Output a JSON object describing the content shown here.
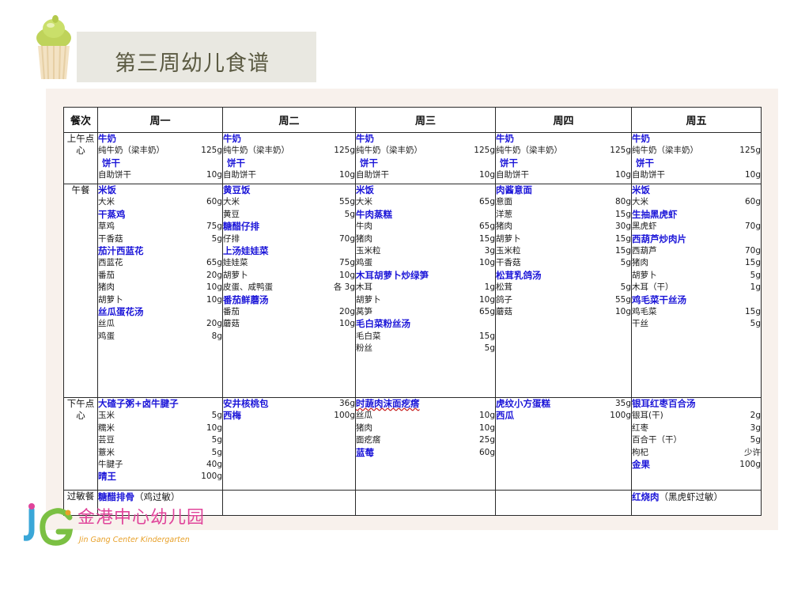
{
  "title": "第三周幼儿食谱",
  "header": [
    "餐次",
    "周一",
    "周二",
    "周三",
    "周四",
    "周五"
  ],
  "meals": [
    {
      "label": "上午点心",
      "days": [
        [
          {
            "t": "d",
            "name": "牛奶"
          },
          {
            "t": "i",
            "name": "纯牛奶（梁丰奶）",
            "qty": "125g"
          },
          {
            "t": "d",
            "name": "饼干",
            "indent": true
          },
          {
            "t": "i",
            "name": "自助饼干",
            "qty": "10g"
          }
        ],
        [
          {
            "t": "d",
            "name": "牛奶"
          },
          {
            "t": "i",
            "name": "纯牛奶（梁丰奶）",
            "qty": "125g"
          },
          {
            "t": "d",
            "name": "饼干",
            "indent": true
          },
          {
            "t": "i",
            "name": "自助饼干",
            "qty": "10g"
          }
        ],
        [
          {
            "t": "d",
            "name": "牛奶"
          },
          {
            "t": "i",
            "name": "纯牛奶（梁丰奶）",
            "qty": "125g"
          },
          {
            "t": "d",
            "name": "饼干",
            "indent": true
          },
          {
            "t": "i",
            "name": "自助饼干",
            "qty": "10g"
          }
        ],
        [
          {
            "t": "d",
            "name": "牛奶"
          },
          {
            "t": "i",
            "name": "纯牛奶（梁丰奶）",
            "qty": "125g"
          },
          {
            "t": "d",
            "name": "饼干",
            "indent": true
          },
          {
            "t": "i",
            "name": "自助饼干",
            "qty": "10g"
          }
        ],
        [
          {
            "t": "d",
            "name": "牛奶"
          },
          {
            "t": "i",
            "name": "纯牛奶（梁丰奶）",
            "qty": "125g"
          },
          {
            "t": "d",
            "name": "饼干",
            "indent": true
          },
          {
            "t": "i",
            "name": "自助饼干",
            "qty": "10g"
          }
        ]
      ]
    },
    {
      "label": "午餐",
      "days": [
        [
          {
            "t": "d",
            "name": "米饭"
          },
          {
            "t": "i",
            "name": "大米",
            "qty": "60g"
          },
          {
            "t": "d",
            "name": "干蒸鸡"
          },
          {
            "t": "i",
            "name": "草鸡",
            "qty": "75g"
          },
          {
            "t": "i",
            "name": "干香菇",
            "qty": "5g"
          },
          {
            "t": "d",
            "name": "茄汁西蓝花"
          },
          {
            "t": "i",
            "name": "西蓝花",
            "qty": "65g"
          },
          {
            "t": "i",
            "name": "番茄",
            "qty": "20g"
          },
          {
            "t": "i",
            "name": "猪肉",
            "qty": "10g"
          },
          {
            "t": "i",
            "name": "胡萝卜",
            "qty": "10g"
          },
          {
            "t": "d",
            "name": "丝瓜蛋花汤"
          },
          {
            "t": "i",
            "name": "丝瓜",
            "qty": "20g"
          },
          {
            "t": "i",
            "name": "鸡蛋",
            "qty": "8g"
          }
        ],
        [
          {
            "t": "d",
            "name": "黄豆饭"
          },
          {
            "t": "i",
            "name": "大米",
            "qty": "55g"
          },
          {
            "t": "i",
            "name": "黄豆",
            "qty": "5g"
          },
          {
            "t": "d",
            "name": "糖醋仔排"
          },
          {
            "t": "i",
            "name": "仔排",
            "qty": "70g"
          },
          {
            "t": "d",
            "name": "上汤娃娃菜"
          },
          {
            "t": "i",
            "name": "娃娃菜",
            "qty": "75g"
          },
          {
            "t": "i",
            "name": "胡萝卜",
            "qty": "10g"
          },
          {
            "t": "i",
            "name": "皮蛋、咸鸭蛋",
            "qty": "各 3g"
          },
          {
            "t": "d",
            "name": "番茄鲜蘑汤"
          },
          {
            "t": "i",
            "name": "番茄",
            "qty": "20g"
          },
          {
            "t": "i",
            "name": "蘑菇",
            "qty": "10g"
          }
        ],
        [
          {
            "t": "d",
            "name": "米饭"
          },
          {
            "t": "i",
            "name": "大米",
            "qty": "65g"
          },
          {
            "t": "d",
            "name": "牛肉蒸糕"
          },
          {
            "t": "i",
            "name": "牛肉",
            "qty": "65g"
          },
          {
            "t": "i",
            "name": "猪肉",
            "qty": "15g"
          },
          {
            "t": "i",
            "name": "玉米粒",
            "qty": "3g"
          },
          {
            "t": "i",
            "name": "鸡蛋",
            "qty": "10g"
          },
          {
            "t": "d",
            "name": "木耳胡萝卜炒绿笋"
          },
          {
            "t": "i",
            "name": "木耳",
            "qty": "1g"
          },
          {
            "t": "i",
            "name": "胡萝卜",
            "qty": "10g"
          },
          {
            "t": "i",
            "name": "莴笋",
            "qty": "65g"
          },
          {
            "t": "d",
            "name": "毛白菜粉丝汤"
          },
          {
            "t": "i",
            "name": "毛白菜",
            "qty": "15g"
          },
          {
            "t": "i",
            "name": "粉丝",
            "qty": "5g"
          }
        ],
        [
          {
            "t": "d",
            "name": "肉酱意面"
          },
          {
            "t": "i",
            "name": "意面",
            "qty": "80g"
          },
          {
            "t": "i",
            "name": "洋葱",
            "qty": "15g"
          },
          {
            "t": "i",
            "name": "猪肉",
            "qty": "30g"
          },
          {
            "t": "i",
            "name": "胡萝卜",
            "qty": "15g"
          },
          {
            "t": "i",
            "name": "玉米粒",
            "qty": "15g"
          },
          {
            "t": "i",
            "name": "干香菇",
            "qty": "5g"
          },
          {
            "t": "d",
            "name": "松茸乳鸽汤"
          },
          {
            "t": "i",
            "name": "松茸",
            "qty": "5g"
          },
          {
            "t": "i",
            "name": "鸽子",
            "qty": "55g"
          },
          {
            "t": "i",
            "name": "蘑菇",
            "qty": "10g"
          }
        ],
        [
          {
            "t": "d",
            "name": "米饭"
          },
          {
            "t": "i",
            "name": "大米",
            "qty": "60g"
          },
          {
            "t": "d",
            "name": "生抽黑虎虾"
          },
          {
            "t": "i",
            "name": "黑虎虾",
            "qty": "70g"
          },
          {
            "t": "d",
            "name": "西葫芦炒肉片"
          },
          {
            "t": "i",
            "name": "西葫芦",
            "qty": "70g"
          },
          {
            "t": "i",
            "name": "猪肉",
            "qty": "15g"
          },
          {
            "t": "i",
            "name": "胡萝卜",
            "qty": "5g"
          },
          {
            "t": "i",
            "name": "木耳（干）",
            "qty": "1g"
          },
          {
            "t": "d",
            "name": "鸡毛菜干丝汤"
          },
          {
            "t": "i",
            "name": "鸡毛菜",
            "qty": "15g"
          },
          {
            "t": "i",
            "name": "干丝",
            "qty": "5g"
          }
        ]
      ]
    },
    {
      "label": "下午点心",
      "days": [
        [
          {
            "t": "d",
            "name": "大碴子粥+卤牛腱子"
          },
          {
            "t": "i",
            "name": "玉米",
            "qty": "5g"
          },
          {
            "t": "i",
            "name": "糯米",
            "qty": "10g"
          },
          {
            "t": "i",
            "name": "芸豆",
            "qty": "5g"
          },
          {
            "t": "i",
            "name": "薏米",
            "qty": "5g"
          },
          {
            "t": "i",
            "name": "牛腱子",
            "qty": "40g"
          },
          {
            "t": "d",
            "name": "晴王",
            "qty": "100g"
          }
        ],
        [
          {
            "t": "d",
            "name": "安井核桃包",
            "qty": "36g"
          },
          {
            "t": "d",
            "name": "西梅",
            "qty": "100g"
          }
        ],
        [
          {
            "t": "d",
            "name": "时蔬肉沫面疙瘩",
            "wavy": true
          },
          {
            "t": "i",
            "name": "丝瓜",
            "qty": "10g"
          },
          {
            "t": "i",
            "name": "猪肉",
            "qty": "10g"
          },
          {
            "t": "i",
            "name": "面疙瘩",
            "qty": "25g"
          },
          {
            "t": "d",
            "name": "蓝莓",
            "qty": "60g"
          }
        ],
        [
          {
            "t": "d",
            "name": "虎纹小方蛋糕",
            "qty": "35g"
          },
          {
            "t": "d",
            "name": "西瓜",
            "qty": "100g"
          }
        ],
        [
          {
            "t": "d",
            "name": "银耳红枣百合汤"
          },
          {
            "t": "i",
            "name": "银耳(干)",
            "qty": "2g"
          },
          {
            "t": "i",
            "name": "红枣",
            "qty": "3g"
          },
          {
            "t": "i",
            "name": "百合干（干）",
            "qty": "5g"
          },
          {
            "t": "i",
            "name": "枸杞",
            "qty": "少许"
          },
          {
            "t": "d",
            "name": "金果",
            "qty": "100g"
          }
        ]
      ]
    },
    {
      "label": "过敏餐",
      "days": [
        [
          {
            "t": "a",
            "name": "糖醋排骨",
            "note": "（鸡过敏）"
          }
        ],
        [],
        [],
        [],
        [
          {
            "t": "a",
            "name": "红烧肉",
            "note": "（黑虎虾过敏）"
          }
        ]
      ]
    }
  ],
  "logo": {
    "cn": "金港中心幼儿园",
    "en": "Jin Gang Center Kindergarten"
  },
  "colors": {
    "dish": "#1b15d8",
    "panel": "#f8f1ec",
    "title_bar": "#e9e8e1",
    "logo_pink": "#e0449a",
    "logo_orange": "#e8a12a"
  }
}
